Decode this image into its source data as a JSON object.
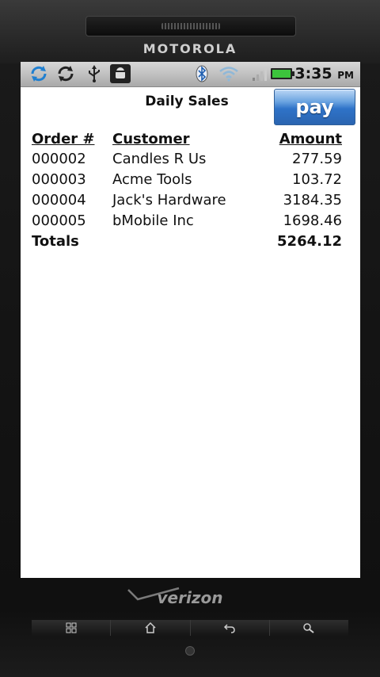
{
  "device": {
    "brand": "MOTOROLA",
    "carrier": "verizon"
  },
  "statusbar": {
    "icons": [
      "sync-blue-icon",
      "sync-icon",
      "usb-icon",
      "android-debug-icon",
      "bluetooth-icon",
      "wifi-icon",
      "signal-icon",
      "battery-icon"
    ],
    "time": "3:35",
    "ampm": "PM"
  },
  "app": {
    "title": "Daily Sales",
    "pay_label": "pay",
    "columns": [
      "Order #",
      "Customer",
      "Amount"
    ],
    "rows": [
      {
        "order": "000002",
        "customer": "Candles R Us",
        "amount": "277.59"
      },
      {
        "order": "000003",
        "customer": "Acme Tools",
        "amount": "103.72"
      },
      {
        "order": "000004",
        "customer": "Jack's Hardware",
        "amount": "3184.35"
      },
      {
        "order": "000005",
        "customer": "bMobile Inc",
        "amount": "1698.46"
      }
    ],
    "totals": {
      "label": "Totals",
      "amount": "5264.12"
    }
  },
  "colors": {
    "pay_button": "#2f73c8",
    "battery": "#3cc43c",
    "screen_bg": "#ffffff"
  }
}
